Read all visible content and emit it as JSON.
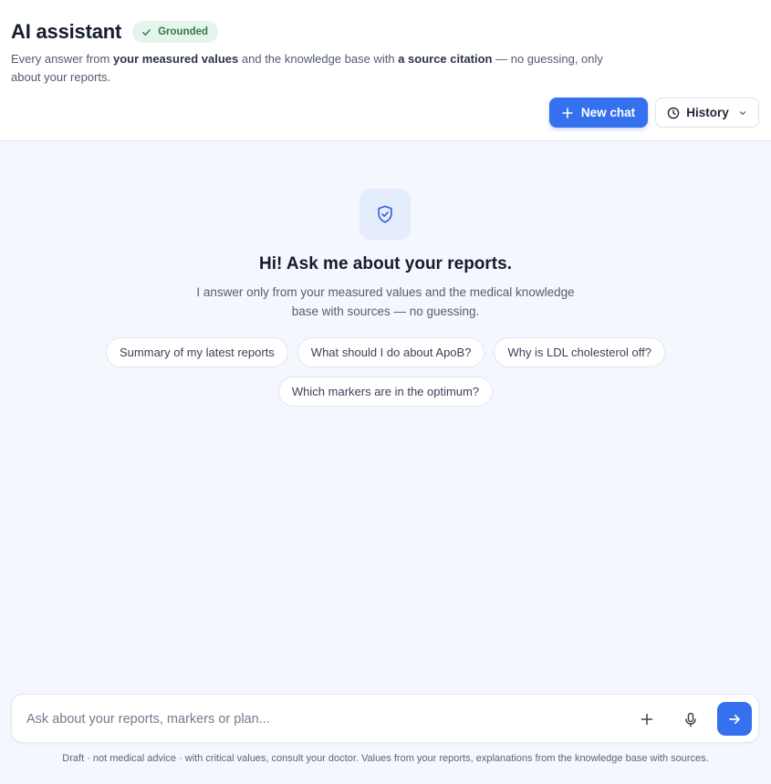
{
  "header": {
    "title": "AI assistant",
    "badge": "Grounded",
    "subtitle": {
      "p1": "Every answer from ",
      "b1": "your measured values",
      "p2": " and the knowledge base with ",
      "b2": "a source citation",
      "p3": " — no guessing, only about your reports."
    },
    "new_chat_label": "New chat",
    "history_label": "History"
  },
  "welcome": {
    "title": "Hi! Ask me about your reports.",
    "description": "I answer only from your measured values and the medical knowledge base with sources — no guessing."
  },
  "suggestions": [
    "Summary of my latest reports",
    "What should I do about ApoB?",
    "Why is LDL cholesterol off?",
    "Which markers are in the optimum?"
  ],
  "composer": {
    "placeholder": "Ask about your reports, markers or plan..."
  },
  "footer": {
    "note": "Draft · not medical advice · with critical values, consult your doctor. Values from your reports, explanations from the knowledge base with sources."
  },
  "icons": {
    "badge": "check-icon",
    "new_chat": "plus-icon",
    "history": "clock-icon",
    "history_caret": "chevron-down-icon",
    "hero": "shield-check-icon",
    "add": "plus-icon",
    "mic": "microphone-icon",
    "send": "arrow-right-icon"
  },
  "colors": {
    "accent": "#3570ee",
    "badge_bg": "#e6f5ec",
    "badge_text": "#2f7a4b",
    "page_bg": "#f4f7fd"
  }
}
